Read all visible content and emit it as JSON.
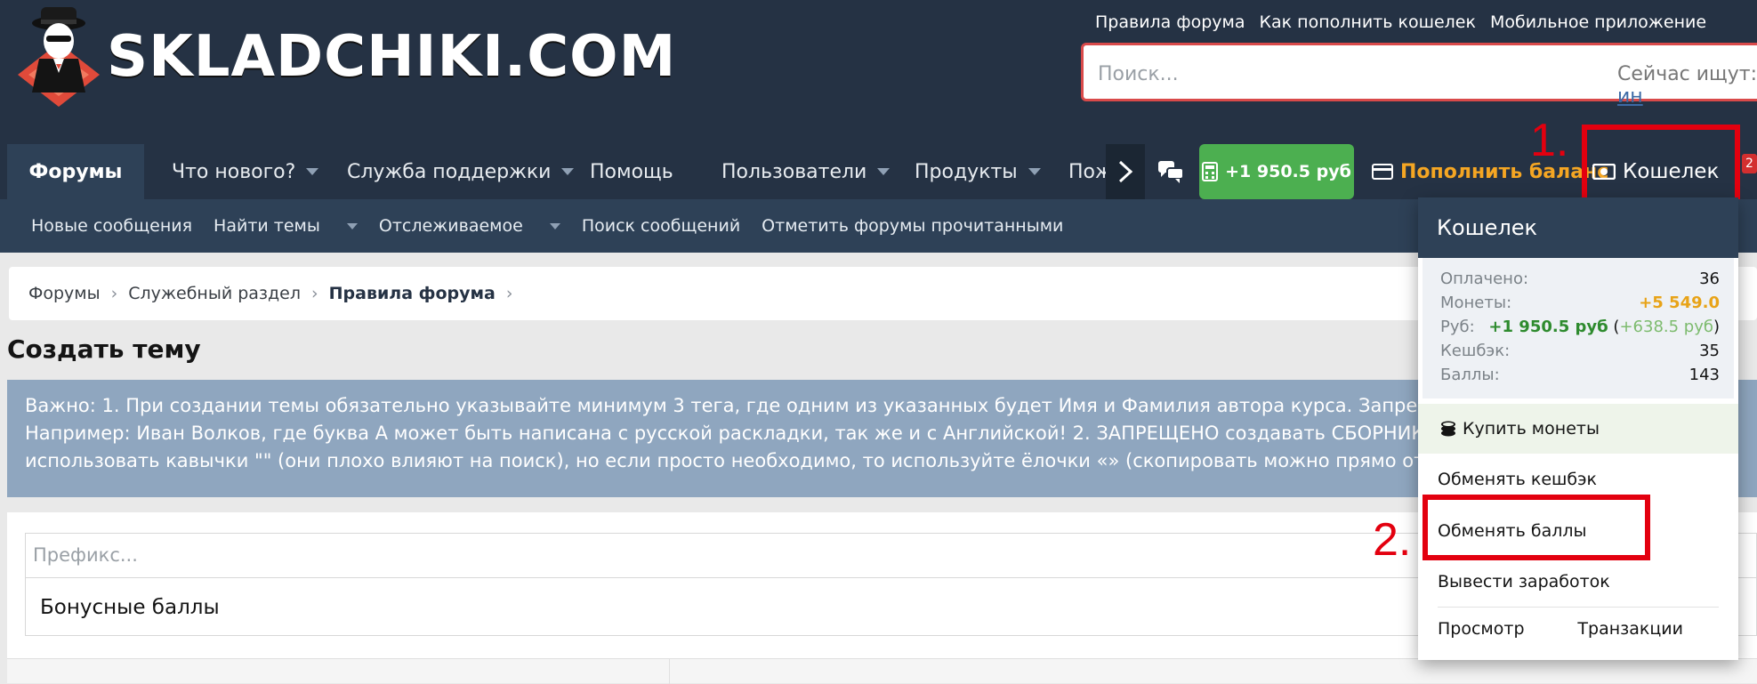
{
  "logo": {
    "text": "SKLADCHIKI.COM"
  },
  "top_links": [
    "Правила форума",
    "Как пополнить кошелек",
    "Мобильное приложение"
  ],
  "search": {
    "placeholder": "Поиск...",
    "now_searching_label": "Сейчас ищут:",
    "now_searching_value": "ин"
  },
  "nav": {
    "tabs": [
      "Форумы",
      "Что нового?",
      "Служба поддержки",
      "Помощь",
      "Пользователи",
      "Продукты",
      "Пож"
    ],
    "balance": "+1 950.5 руб",
    "topup": "Пополнить баланс",
    "wallet": "Кошелек",
    "badge": "2"
  },
  "subnav": [
    "Новые сообщения",
    "Найти темы",
    "Отслеживаемое",
    "Поиск сообщений",
    "Отметить форумы прочитанными"
  ],
  "breadcrumb": [
    "Форумы",
    "Служебный раздел",
    "Правила форума"
  ],
  "page_title": "Создать тему",
  "notice": {
    "lines": [
      "Важно: 1. При создании темы обязательно указывайте минимум 3 тега, где одним из указанных будет Имя и Фамилия автора курса. Запрещено писать",
      "Например: Иван Волков, где буква А может быть написана с русской раскладки, так же и с Английской! 2. ЗАПРЕЩЕНО создавать СБОРНИКИ складчин",
      "использовать кавычки \"\" (они плохо влияют на поиск), но если просто необходимо, то используйте ёлочки «» (скопировать можно прямо отсюда)"
    ]
  },
  "form": {
    "prefix_placeholder": "Префикс...",
    "title_value": "Бонусные баллы"
  },
  "wallet_dropdown": {
    "title": "Кошелек",
    "stats": {
      "paid_label": "Оплачено:",
      "paid_value": "36",
      "coins_label": "Монеты:",
      "coins_value": "+5 549.0",
      "rub_label": "Руб:",
      "rub_value": "+1 950.5 руб",
      "rub_extra": "+638.5 руб",
      "cashback_label": "Кешбэк:",
      "cashback_value": "35",
      "points_label": "Баллы:",
      "points_value": "143"
    },
    "items": [
      "Купить монеты",
      "Обменять кешбэк",
      "Обменять баллы",
      "Вывести заработок"
    ],
    "footer": [
      "Просмотр",
      "Транзакции"
    ]
  },
  "annotations": {
    "step1": "1.",
    "step2": "2."
  },
  "colors": {
    "header": "#253244",
    "subnav": "#2e4157",
    "accent_green": "#4caf50",
    "accent_gold": "#f5a623",
    "highlight_red": "#e3000f",
    "notice": "#8fa6bf"
  }
}
